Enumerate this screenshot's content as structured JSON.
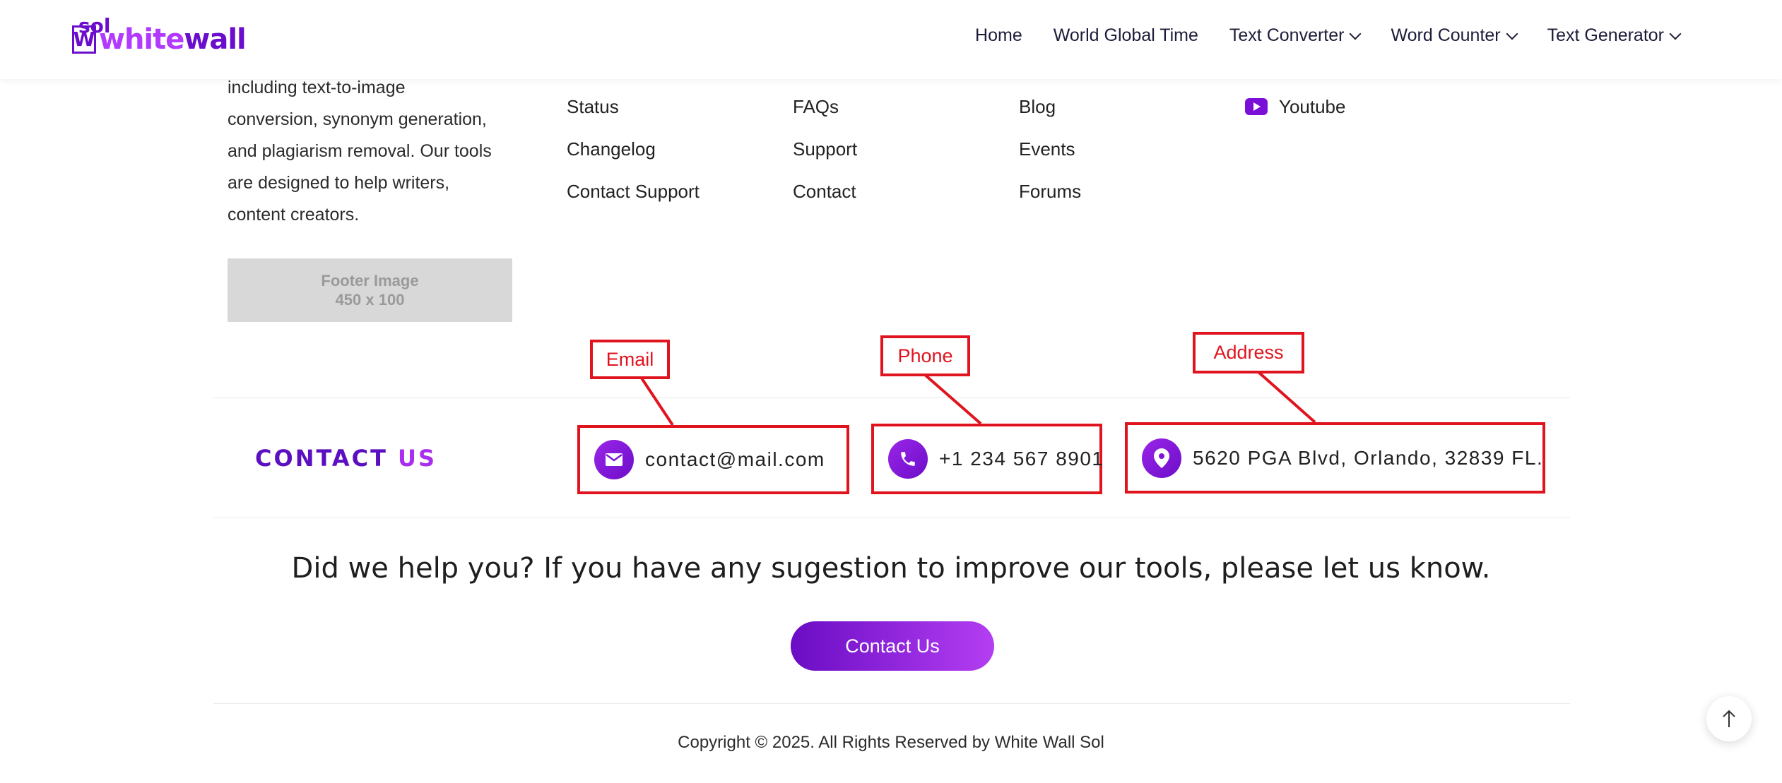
{
  "header": {
    "logo": {
      "sol": "sol",
      "white": "white",
      "wall": "wall",
      "mark": "W"
    },
    "nav": [
      {
        "label": "Home",
        "dropdown": false
      },
      {
        "label": "World Global Time",
        "dropdown": false
      },
      {
        "label": "Text Converter",
        "dropdown": true
      },
      {
        "label": "Word Counter",
        "dropdown": true
      },
      {
        "label": "Text Generator",
        "dropdown": true
      }
    ]
  },
  "footer": {
    "about_lines": [
      "including text-to-image",
      "conversion, synonym generation,",
      "and plagiarism removal. Our tools",
      "are designed to help writers,",
      "content creators."
    ],
    "footer_image": {
      "line1": "Footer Image",
      "line2": "450 x 100"
    },
    "columns": [
      [
        "Status",
        "Changelog",
        "Contact Support"
      ],
      [
        "FAQs",
        "Support",
        "Contact"
      ],
      [
        "Blog",
        "Events",
        "Forums"
      ]
    ],
    "social": {
      "youtube": "Youtube",
      "icon": "youtube-icon"
    }
  },
  "contact": {
    "title_part1": "CONTACT",
    "title_part2": "US",
    "email": "contact@mail.com",
    "phone": "+1 234 567 8901",
    "address": "5620 PGA Blvd, Orlando, 32839 FL."
  },
  "annotations": {
    "email": "Email",
    "phone": "Phone",
    "address": "Address"
  },
  "cta": {
    "text": "Did we help you? If you have any sugestion to improve our tools, please let us know.",
    "button": "Contact Us"
  },
  "copyright": "Copyright © 2025. All Rights Reserved by White Wall Sol",
  "colors": {
    "accent": "#6a0dcc",
    "accent_light": "#b23aff",
    "annotation": "#e0141e"
  }
}
